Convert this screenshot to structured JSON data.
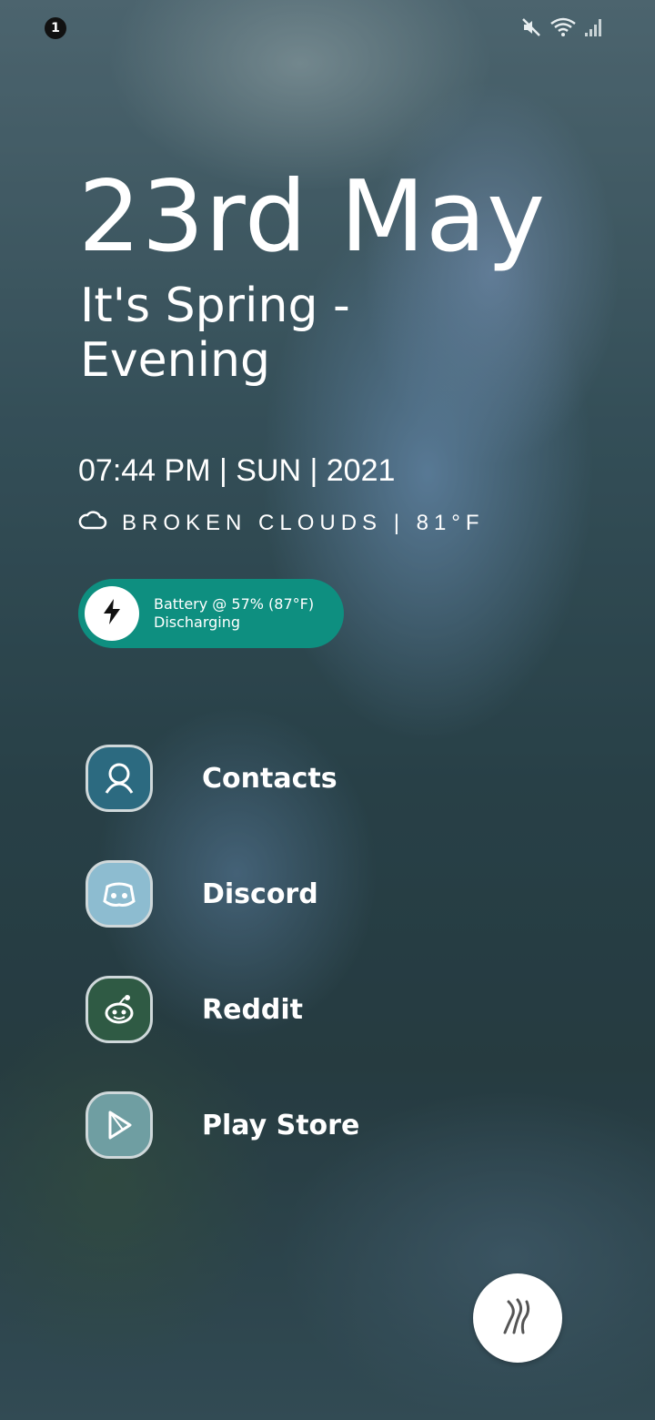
{
  "status_bar": {
    "notification_count": "1",
    "icons": [
      "mute-icon",
      "wifi-icon",
      "signal-icon"
    ]
  },
  "header": {
    "date": "23rd May",
    "season_line1": "It's Spring -",
    "season_line2": "Evening",
    "time_line": "07:44 PM | SUN | 2021",
    "weather": "BROKEN CLOUDS | 81°F",
    "weather_icon": "cloud-icon"
  },
  "battery": {
    "line1": "Battery @ 57% (87°F)",
    "line2": "Discharging",
    "icon": "lightning-icon",
    "color": "#0e8f80",
    "level_percent": 57
  },
  "apps": [
    {
      "label": "Contacts",
      "icon": "contacts-icon",
      "color": "#2c6a80"
    },
    {
      "label": "Discord",
      "icon": "discord-icon",
      "color": "#8dbcd0"
    },
    {
      "label": "Reddit",
      "icon": "reddit-icon",
      "color": "#2f5a44"
    },
    {
      "label": "Play Store",
      "icon": "play-store-icon",
      "color": "#6f9ea2"
    }
  ],
  "fab": {
    "icon": "launcher-logo-icon"
  }
}
